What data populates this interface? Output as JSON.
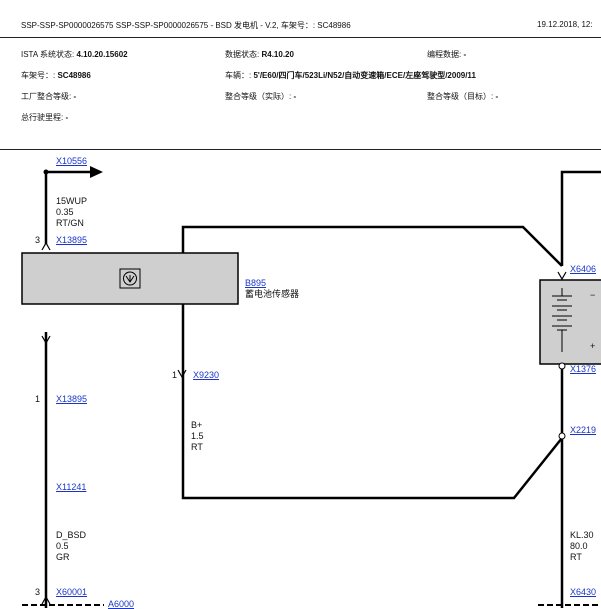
{
  "header": {
    "title": "SSP-SSP-SP0000026575 SSP-SSP-SP0000026575 - BSD 发电机 - V.2, 车架号：: SC48986",
    "datetime": "19.12.2018, 12:"
  },
  "info": {
    "ista_label": "ISTA 系统状态:",
    "ista_value": "4.10.20.15602",
    "data_label": "数据状态:",
    "data_value": "R4.10.20",
    "prog_label": "编程数据:",
    "prog_value": "-",
    "vin_label": "车架号：:",
    "vin_value": "SC48986",
    "vehicle_label": "车辆：:",
    "vehicle_value": "5'/E60/四门车/523Li/N52/自动变速箱/ECE/左座驾驶型/2009/11",
    "factory_label": "工厂整合等级:",
    "factory_value": "-",
    "actual_label": "整合等级（实际）:",
    "actual_value": "-",
    "target_label": "整合等级（目标）:",
    "target_value": "-",
    "mileage_label": "总行驶里程:",
    "mileage_value": "-"
  },
  "diagram": {
    "connectors": {
      "x10556": "X10556",
      "x13895_top": "X13895",
      "x9230": "X9230",
      "x13895_bot": "X13895",
      "x11241": "X11241",
      "x60001": "X60001",
      "a6000": "A6000",
      "x6406": "X6406",
      "x1376": "X1376",
      "x2219": "X2219",
      "x6430": "X6430"
    },
    "component": {
      "id": "B895",
      "name": "蓄电池传感器"
    },
    "pins": {
      "p3_top": "3",
      "p1_x9230": "1",
      "p1_x13895": "1",
      "p3_x60001": "3"
    },
    "wires": {
      "w15wup": [
        "15WUP",
        "0.35",
        "RT/GN"
      ],
      "wbplus": [
        "B+",
        "1.5",
        "RT"
      ],
      "wdbsd": [
        "D_BSD",
        "0.5",
        "GR"
      ],
      "wkl30": [
        "KL.30",
        "80.0",
        "RT"
      ]
    },
    "battery_symbols": {
      "minus": "−",
      "plus": "+"
    }
  }
}
